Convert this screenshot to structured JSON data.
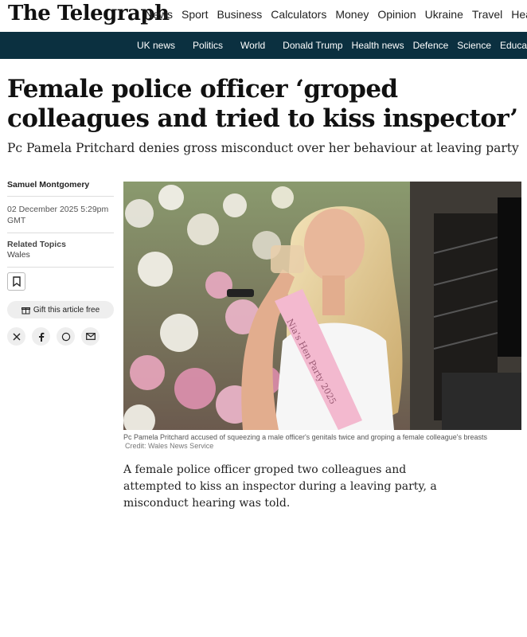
{
  "header": {
    "logo": "The Telegraph",
    "nav": [
      "News",
      "Sport",
      "Business",
      "Calculators",
      "Money",
      "Opinion",
      "Ukraine",
      "Travel",
      "Health"
    ]
  },
  "subnav": [
    "UK news",
    "Politics",
    "World",
    "Donald Trump",
    "Health news",
    "Defence",
    "Science",
    "Education"
  ],
  "article": {
    "headline": "Female police officer ‘groped colleagues and tried to kiss inspector’",
    "standfirst": "Pc Pamela Pritchard denies gross misconduct over her behaviour at leaving party",
    "author": "Samuel Montgomery",
    "date": "02 December 2025 5:29pm GMT",
    "related_label": "Related Topics",
    "related_topic": "Wales",
    "gift_label": "Gift this article free",
    "sash_text": "Nia's Hen Party 2025",
    "caption": "Pc Pamela Pritchard accused of squeezing a male officer's genitals twice and groping a female colleague's breasts",
    "credit": "Credit: Wales News Service",
    "body": "A female police officer groped two colleagues and attempted to kiss an inspector during a leaving party, a misconduct hearing was told."
  },
  "icons": {
    "bookmark": "bookmark-icon",
    "gift": "gift-icon",
    "share": [
      "x-icon",
      "facebook-icon",
      "whatsapp-icon",
      "email-icon"
    ]
  }
}
